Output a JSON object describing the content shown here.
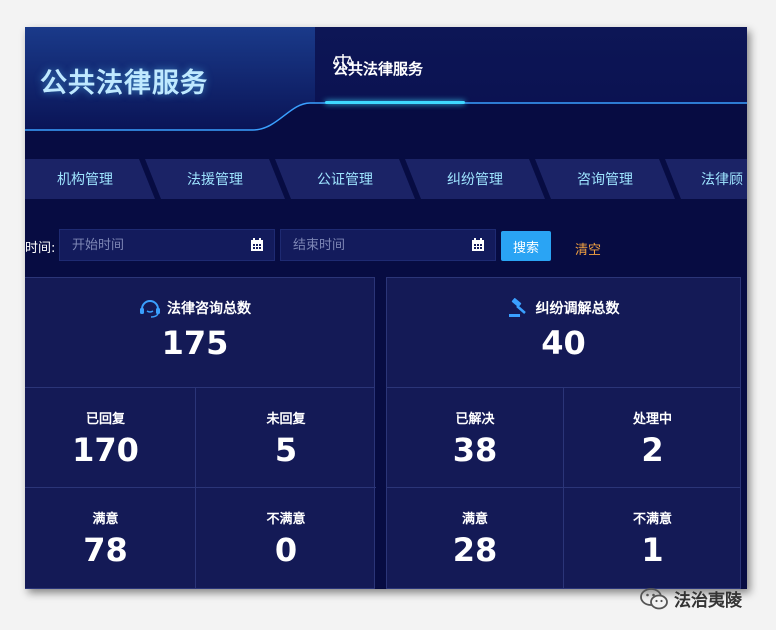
{
  "header": {
    "title": "公共法律服务",
    "active_tab": "公共法律服务"
  },
  "nav": {
    "items": [
      "机构管理",
      "法援管理",
      "公证管理",
      "纠纷管理",
      "咨询管理",
      "法律顾"
    ]
  },
  "filter": {
    "label": "时间:",
    "start_placeholder": "开始时间",
    "end_placeholder": "结束时间",
    "search_label": "搜索",
    "clear_label": "清空"
  },
  "consult": {
    "title": "法律咨询总数",
    "total": "175",
    "replied_label": "已回复",
    "replied": "170",
    "unreplied_label": "未回复",
    "unreplied": "5",
    "satisfied_label": "满意",
    "satisfied": "78",
    "unsatisfied_label": "不满意",
    "unsatisfied": "0"
  },
  "dispute": {
    "title": "纠纷调解总数",
    "total": "40",
    "resolved_label": "已解决",
    "resolved": "38",
    "processing_label": "处理中",
    "processing": "2",
    "satisfied_label": "满意",
    "satisfied": "28",
    "unsatisfied_label": "不满意",
    "unsatisfied": "1"
  },
  "watermark": {
    "text": "法治夷陵"
  },
  "colors": {
    "background": "#070c42",
    "panel": "#141a56",
    "accent": "#3fd9ff",
    "search_button": "#2aa4f4",
    "clear_link": "#f0a040"
  }
}
